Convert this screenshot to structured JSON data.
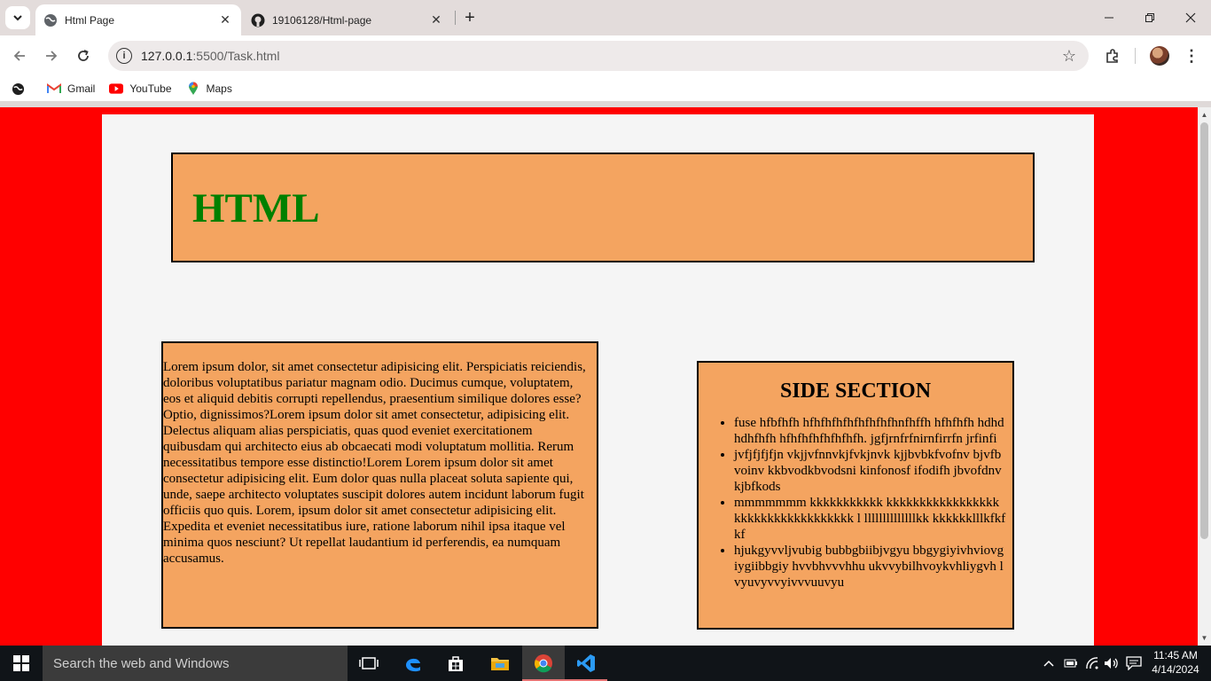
{
  "browser": {
    "tabs": [
      {
        "title": "Html Page",
        "active": true
      },
      {
        "title": "19106128/Html-page",
        "active": false
      }
    ],
    "url_host": "127.0.0.1",
    "url_path": ":5500/Task.html",
    "bookmarks": [
      {
        "label": "Gmail",
        "icon": "gmail-icon"
      },
      {
        "label": "YouTube",
        "icon": "youtube-icon"
      },
      {
        "label": "Maps",
        "icon": "maps-icon"
      }
    ]
  },
  "page": {
    "heading": "HTML",
    "main_text": "Lorem ipsum dolor, sit amet consectetur adipisicing elit. Perspiciatis reiciendis, doloribus voluptatibus pariatur magnam odio. Ducimus cumque, voluptatem, eos et aliquid debitis corrupti repellendus, praesentium similique dolores esse? Optio, dignissimos?Lorem ipsum dolor sit amet consectetur, adipisicing elit. Delectus aliquam alias perspiciatis, quas quod eveniet exercitationem quibusdam qui architecto eius ab obcaecati modi voluptatum mollitia. Rerum necessitatibus tempore esse distinctio!Lorem Lorem ipsum dolor sit amet consectetur adipisicing elit. Eum dolor quas nulla placeat soluta sapiente qui, unde, saepe architecto voluptates suscipit dolores autem incidunt laborum fugit officiis quo quis. Lorem, ipsum dolor sit amet consectetur adipisicing elit. Expedita et eveniet necessitatibus iure, ratione laborum nihil ipsa itaque vel minima quos nesciunt? Ut repellat laudantium id perferendis, ea numquam accusamus.",
    "side": {
      "title": "SIDE SECTION",
      "items": [
        "fuse hfbfhfh hfhfhfhfhfhfhfhfhnfhffh hfhfhfh hdhdhdhfhfh hfhfhfhfhfhfhfh. jgfjrnfrfnirnfirrfn jrfinfi",
        "jvfjfjfjfjn vkjjvfnnvkjfvkjnvk kjjbvbkfvofnv bjvfbvoinv kkbvodkbvodsni kinfonosf ifodifh jbvofdnv kjbfkods",
        "mmmmmmm kkkkkkkkkkk kkkkkkkkkkkkkkkkk kkkkkkkkkkkkkkkkkk l llllllllllllllkk kkkkkklllkfkfkf",
        "hjukgyvvljvubig bubbgbiibjvgyu bbgygiyivhviovgiygiibbgiy hvvbhvvvhhu ukvvybilhvoykvhliygvh lvyuvyvvyivvvuuvyu"
      ]
    }
  },
  "taskbar": {
    "search_placeholder": "Search the web and Windows",
    "time": "11:45 AM",
    "date": "4/14/2024"
  },
  "colors": {
    "page_background": "#ff0000",
    "box_fill": "#f4a460",
    "heading_color": "#008000"
  }
}
